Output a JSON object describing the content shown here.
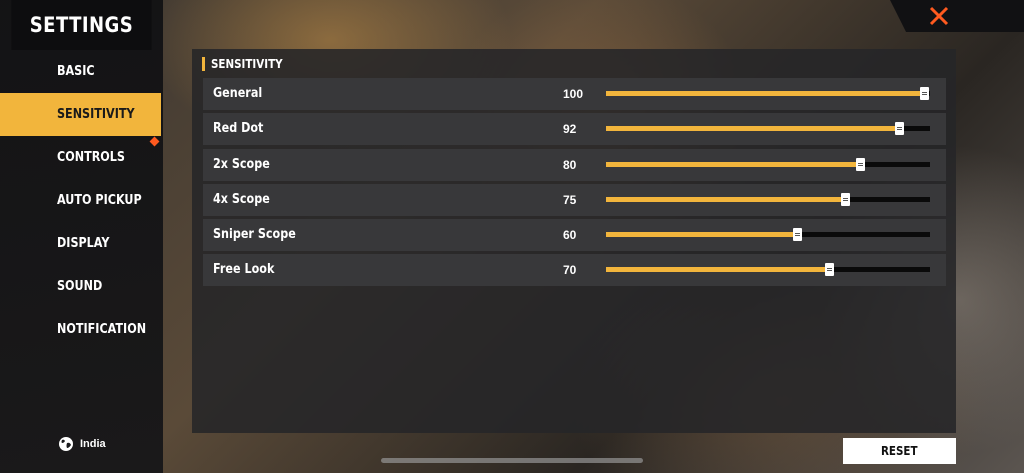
{
  "sidebar": {
    "title": "SETTINGS",
    "items": [
      {
        "label": "BASIC",
        "active": false
      },
      {
        "label": "SENSITIVITY",
        "active": true
      },
      {
        "label": "CONTROLS",
        "active": false
      },
      {
        "label": "AUTO PICKUP",
        "active": false
      },
      {
        "label": "DISPLAY",
        "active": false
      },
      {
        "label": "SOUND",
        "active": false
      },
      {
        "label": "NOTIFICATION",
        "active": false
      }
    ],
    "region": {
      "icon": "globe-icon",
      "label": "India"
    }
  },
  "close": {
    "icon": "close-icon"
  },
  "section": {
    "title": "SENSITIVITY"
  },
  "sensitivity": {
    "max": 100,
    "rows": [
      {
        "label": "General",
        "value": "100"
      },
      {
        "label": "Red Dot",
        "value": "92"
      },
      {
        "label": "2x Scope",
        "value": "80"
      },
      {
        "label": "4x Scope",
        "value": "75"
      },
      {
        "label": "Sniper Scope",
        "value": "60"
      },
      {
        "label": "Free Look",
        "value": "70"
      }
    ]
  },
  "actions": {
    "reset_label": "RESET"
  },
  "colors": {
    "accent": "#f2b53c",
    "notify": "#ff5a1f",
    "close": "#ff5a1f"
  }
}
